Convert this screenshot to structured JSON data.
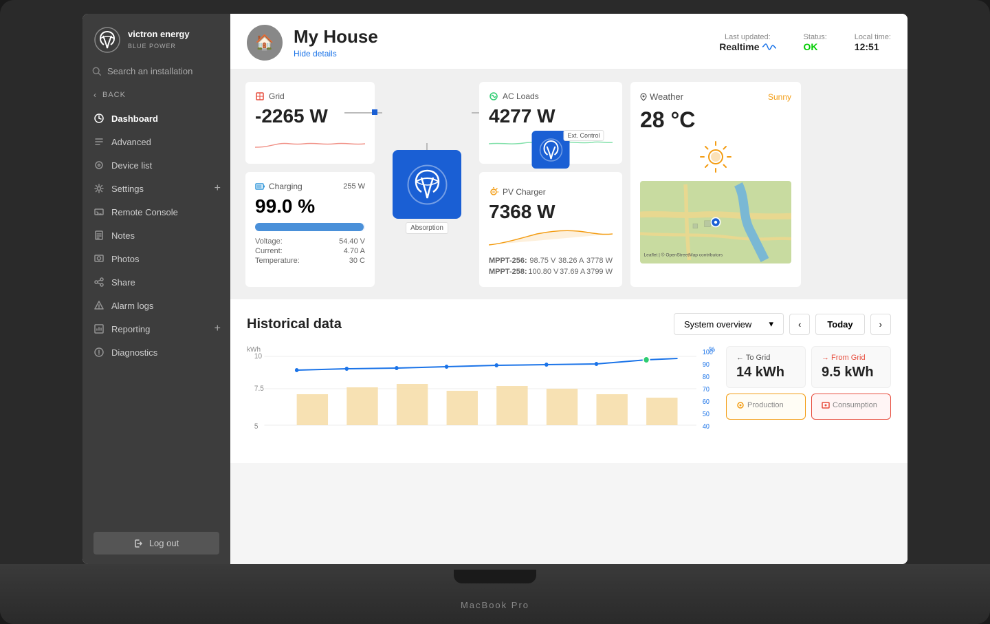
{
  "laptop": {
    "brand": "MacBook Pro"
  },
  "sidebar": {
    "logo_text": "victron energy",
    "logo_tagline": "BLUE POWER",
    "search_placeholder": "Search an installation",
    "back_label": "BACK",
    "nav_items": [
      {
        "id": "dashboard",
        "label": "Dashboard",
        "icon": "dashboard-icon",
        "active": true
      },
      {
        "id": "advanced",
        "label": "Advanced",
        "icon": "advanced-icon"
      },
      {
        "id": "device-list",
        "label": "Device list",
        "icon": "device-list-icon"
      },
      {
        "id": "settings",
        "label": "Settings",
        "icon": "settings-icon",
        "has_plus": true
      },
      {
        "id": "remote-console",
        "label": "Remote Console",
        "icon": "remote-console-icon"
      },
      {
        "id": "notes",
        "label": "Notes",
        "icon": "notes-icon"
      },
      {
        "id": "photos",
        "label": "Photos",
        "icon": "photos-icon"
      },
      {
        "id": "share",
        "label": "Share",
        "icon": "share-icon"
      },
      {
        "id": "alarm-logs",
        "label": "Alarm logs",
        "icon": "alarm-logs-icon"
      },
      {
        "id": "reporting",
        "label": "Reporting",
        "icon": "reporting-icon",
        "has_plus": true
      },
      {
        "id": "diagnostics",
        "label": "Diagnostics",
        "icon": "diagnostics-icon"
      }
    ],
    "logout_label": "Log out"
  },
  "header": {
    "title": "My House",
    "hide_details": "Hide details",
    "last_updated_label": "Last updated:",
    "last_updated_value": "Realtime",
    "status_label": "Status:",
    "status_value": "OK",
    "local_time_label": "Local time:",
    "local_time_value": "12:51"
  },
  "widgets": {
    "grid": {
      "label": "Grid",
      "value": "-2265 W",
      "icon_color": "#e74c3c"
    },
    "inverter": {
      "label": "Absorption",
      "badge": "Absorption"
    },
    "ac_loads": {
      "label": "AC Loads",
      "value": "4277 W"
    },
    "battery": {
      "label": "Charging",
      "charging_w": "255 W",
      "percent": "99.0 %",
      "voltage_label": "Voltage:",
      "voltage_value": "54.40 V",
      "current_label": "Current:",
      "current_value": "4.70 A",
      "temperature_label": "Temperature:",
      "temperature_value": "30 C",
      "bar_percent": 99
    },
    "pv_charger": {
      "label": "PV Charger",
      "value": "7368 W",
      "badge": "Ext. Control",
      "mppt1_label": "MPPT-256:",
      "mppt1_v": "98.75 V",
      "mppt1_a": "38.26 A",
      "mppt1_w": "3778 W",
      "mppt2_label": "MPPT-258:",
      "mppt2_v": "100.80 V",
      "mppt2_a": "37.69 A",
      "mppt2_w": "3799 W"
    },
    "weather": {
      "location": "Weather",
      "condition": "Sunny",
      "temperature": "28 °C"
    }
  },
  "historical": {
    "title": "Historical data",
    "dropdown_value": "System overview",
    "nav_prev": "<",
    "nav_next": ">",
    "today_label": "Today",
    "chart_y_label": "kWh",
    "chart_y_right": "%",
    "chart_y_values": [
      10,
      7.5,
      5
    ],
    "chart_percent_values": [
      100,
      90,
      80,
      70,
      60,
      50,
      40
    ],
    "stats": {
      "to_grid_label": "← To Grid",
      "to_grid_value": "14 kWh",
      "from_grid_label": "→ From Grid",
      "from_grid_value": "9.5 kWh",
      "production_label": "Production",
      "consumption_label": "Consumption"
    }
  }
}
